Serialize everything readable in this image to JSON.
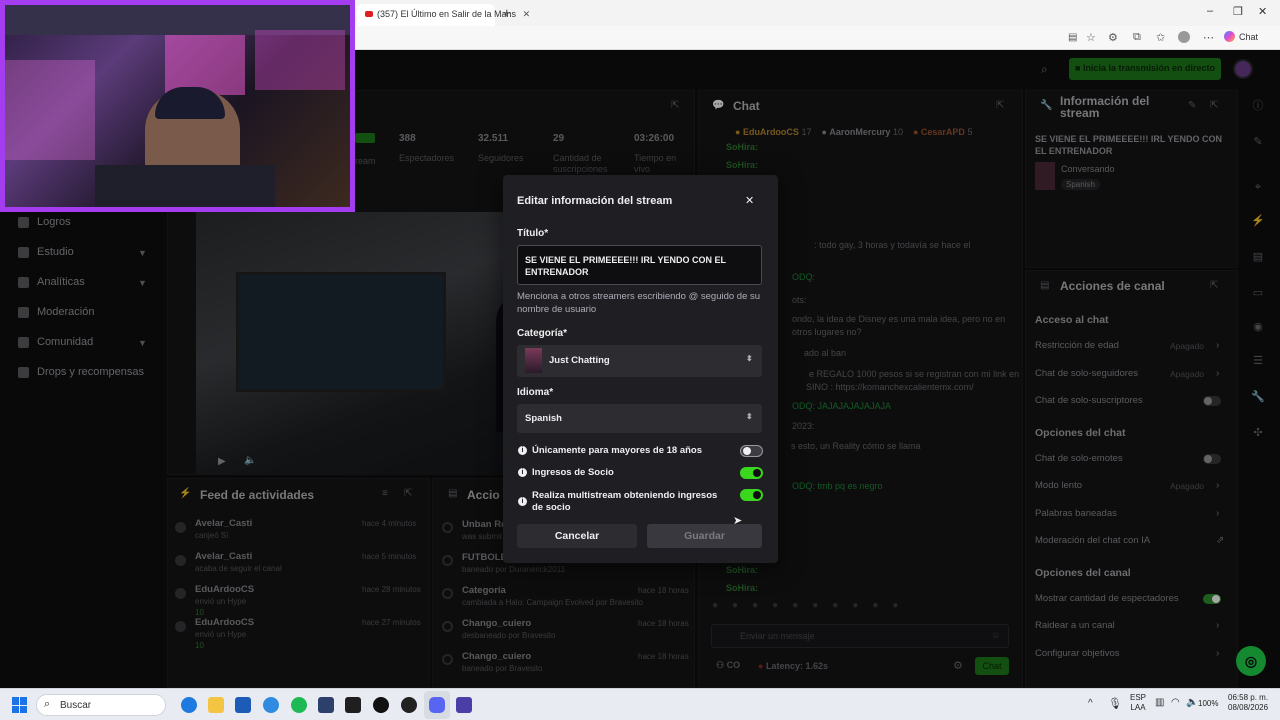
{
  "browser": {
    "tab_title": "(357) El Último en Salir de la Mans",
    "chat_label": "Chat"
  },
  "topbar": {
    "go_live": "Inicia la transmisión en directo"
  },
  "sidebar": {
    "items": [
      {
        "label": "Logros"
      },
      {
        "label": "Estudio"
      },
      {
        "label": "Analíticas"
      },
      {
        "label": "Moderación"
      },
      {
        "label": "Comunidad"
      },
      {
        "label": "Drops y recompensas"
      }
    ]
  },
  "stats": {
    "live_partial": "ream",
    "items": [
      {
        "value": "388",
        "label": "Espectadores"
      },
      {
        "value": "32.511",
        "label": "Seguidores"
      },
      {
        "value": "29",
        "label": "Cantidad de suscripciones"
      },
      {
        "value": "03:26:00",
        "label": "Tiempo en vivo"
      }
    ]
  },
  "activity_feed": {
    "title": "Feed de actividades",
    "items": [
      {
        "name": "Avelar_Casti",
        "time": "hace 4 minutos",
        "detail": "canjeó Sí"
      },
      {
        "name": "Avelar_Casti",
        "time": "hace 5 minutos",
        "detail": "acaba de seguir el canal"
      },
      {
        "name": "EduArdooCS",
        "time": "hace 28 minutos",
        "detail": "envió un Hype",
        "count": "10"
      },
      {
        "name": "EduArdooCS",
        "time": "hace 27 minutos",
        "detail": "envió un Hype",
        "count": "10"
      }
    ]
  },
  "actions_panel": {
    "title": "Accio",
    "items": [
      {
        "name": "Unban Re",
        "time": "",
        "detail": "was submit"
      },
      {
        "name": "FUTBOLE",
        "time": "",
        "detail": "baneado por Duranerick2011"
      },
      {
        "name": "Categoría",
        "time": "hace 18 horas",
        "detail": "cambiada a Halo: Campaign Evolved por Bravesito"
      },
      {
        "name": "Chango_cuiero",
        "time": "hace 18 horas",
        "detail": "desbaneado por Bravesito"
      },
      {
        "name": "Chango_cuiero",
        "time": "hace 18 horas",
        "detail": "baneado por Bravesito"
      }
    ]
  },
  "chat": {
    "title": "Chat",
    "top_users": [
      {
        "name": "EduArdooCS",
        "count": "17"
      },
      {
        "name": "AaronMercury",
        "count": "10"
      },
      {
        "name": "CesarAPD",
        "count": "5"
      }
    ],
    "messages": [
      "SoHira:",
      "SoHira:",
      ": todo gay, 3 horas y todavía se hace el",
      "ODQ:",
      "ots:",
      "ondo, la idea de Disney es una mala idea, pero no en",
      "otros lugares no?",
      "ado al ban",
      "e REGALO 1000 pesos  si se registran con mi link en",
      "SINO : https://komanchexcalientemx.com/",
      "ODQ: JAJAJAJAJAJAJA",
      "2023:",
      "s esto, un Reality cómo se llama",
      "ODQ: tmb pq es negro",
      "SoHira:",
      "SoHira:"
    ],
    "input_placeholder": "Enviar un mensaje",
    "latency": "Latency: 1.62s",
    "co_label": "CO",
    "send_label": "Chat"
  },
  "stream_info": {
    "title": "Información del stream",
    "stream_title": "SE VIENE EL PRIMEEEE!!! IRL YENDO CON EL ENTRENADOR",
    "category": "Conversando",
    "language": "Spanish"
  },
  "channel_actions": {
    "title": "Acciones de canal",
    "sections": [
      {
        "heading": "Acceso al chat",
        "items": [
          {
            "label": "Restricción de edad",
            "value": "Apagado",
            "kind": "link"
          },
          {
            "label": "Chat de solo-seguidores",
            "value": "Apagado",
            "kind": "link"
          },
          {
            "label": "Chat de solo-suscriptores",
            "value": "",
            "kind": "toggle",
            "on": false
          }
        ]
      },
      {
        "heading": "Opciones del chat",
        "items": [
          {
            "label": "Chat de solo-emotes",
            "value": "",
            "kind": "toggle",
            "on": false
          },
          {
            "label": "Modo lento",
            "value": "Apagado",
            "kind": "link"
          },
          {
            "label": "Palabras baneadas",
            "value": "",
            "kind": "link"
          },
          {
            "label": "Moderación del chat con IA",
            "value": "",
            "kind": "ext"
          }
        ]
      },
      {
        "heading": "Opciones del canal",
        "items": [
          {
            "label": "Mostrar cantidad de espectadores",
            "value": "",
            "kind": "toggle",
            "on": true
          },
          {
            "label": "Raidear a un canal",
            "value": "",
            "kind": "link"
          },
          {
            "label": "Configurar objetivos",
            "value": "",
            "kind": "link"
          }
        ]
      }
    ]
  },
  "modal": {
    "title": "Editar información del stream",
    "title_label": "Título*",
    "title_value": "SE VIENE EL PRIMEEEE!!! IRL YENDO CON EL ENTRENADOR",
    "mention_help": "Menciona a otros streamers escribiendo @ seguido de su nombre de usuario",
    "category_label": "Categoría*",
    "category_value": "Just Chatting",
    "language_label": "Idioma*",
    "language_value": "Spanish",
    "options": [
      {
        "label": "Únicamente para mayores de 18 años",
        "on": false
      },
      {
        "label": "Ingresos de Socio",
        "on": true
      },
      {
        "label": "Realiza multistream obteniendo ingresos de socio",
        "on": true
      }
    ],
    "cancel": "Cancelar",
    "save": "Guardar"
  },
  "taskbar": {
    "search": "Buscar",
    "lang_top": "ESP",
    "lang_bottom": "LAA",
    "battery": "100%",
    "time": "06:58 p. m.",
    "date": "08/08/2026"
  }
}
